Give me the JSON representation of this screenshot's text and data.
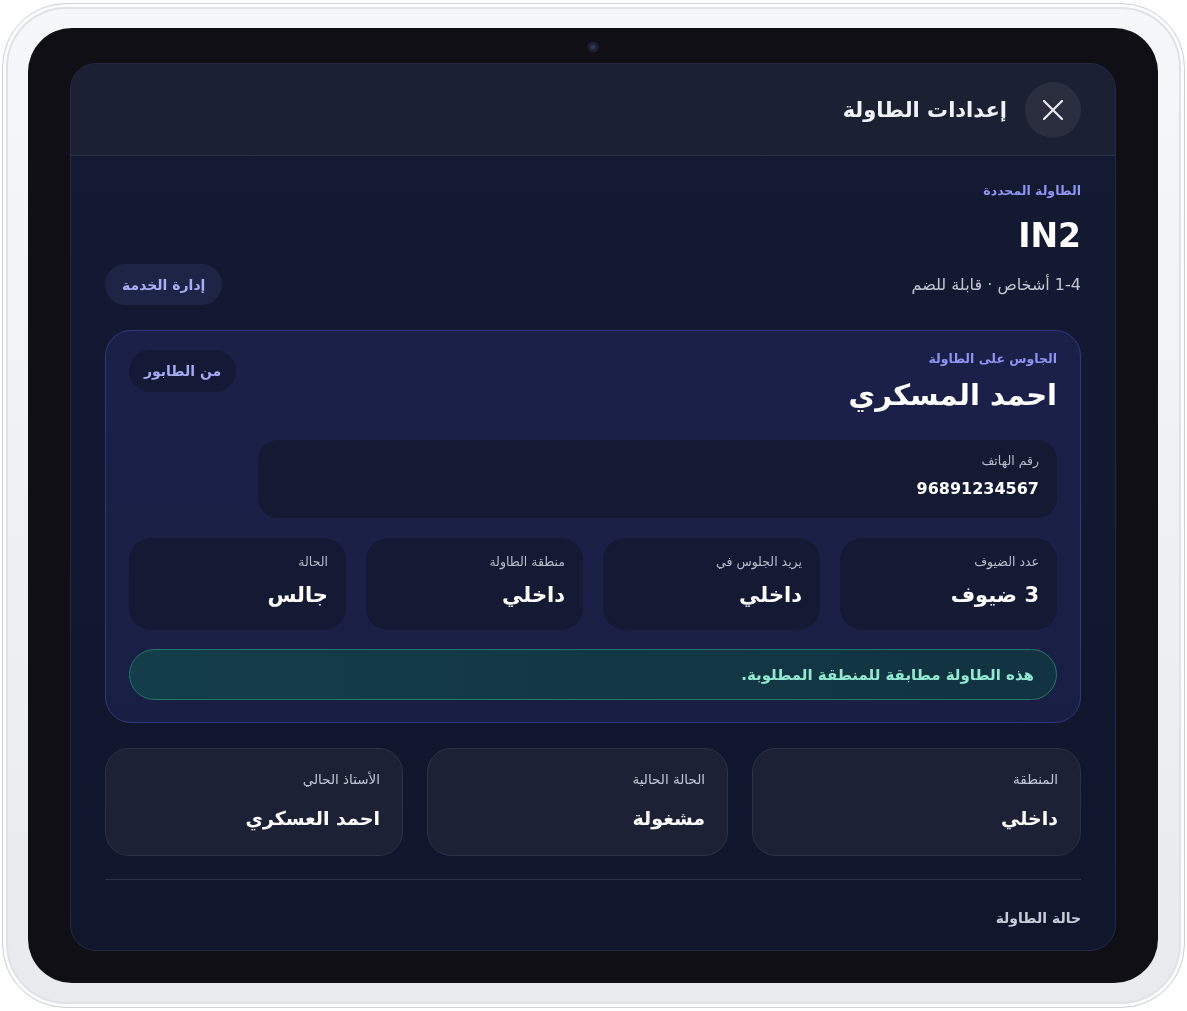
{
  "dialog": {
    "title": "إعدادات الطاولة"
  },
  "selected_table": {
    "label": "الطاولة المحددة",
    "name": "IN2",
    "details": "1-4 أشخاص · قابلة للضم",
    "action": "إدارة الخدمة"
  },
  "seated": {
    "label": "الجاوس على الطاولة",
    "name": "احمد المسكري",
    "source": "من الطابور",
    "phone": {
      "label": "رقم الهاتف",
      "value": "96891234567"
    },
    "stats": [
      {
        "label": "عدد الضيوف",
        "value": "3 ضيوف"
      },
      {
        "label": "يريد الجلوس في",
        "value": "داخلي"
      },
      {
        "label": "منطقة الطاولة",
        "value": "داخلي"
      },
      {
        "label": "الحالة",
        "value": "جالس"
      }
    ],
    "notice": {
      "kind": "success",
      "text": "هذه الطاولة مطابقة للمنطقة المطلوبة."
    }
  },
  "table_info": [
    {
      "label": "المنطقة",
      "value": "داخلي"
    },
    {
      "label": "الحالة الحالية",
      "value": "مشغولة"
    },
    {
      "label": "الأستاذ الحالي",
      "value": "احمد العسكري"
    }
  ],
  "status_section": {
    "title": "حالة الطاولة"
  }
}
